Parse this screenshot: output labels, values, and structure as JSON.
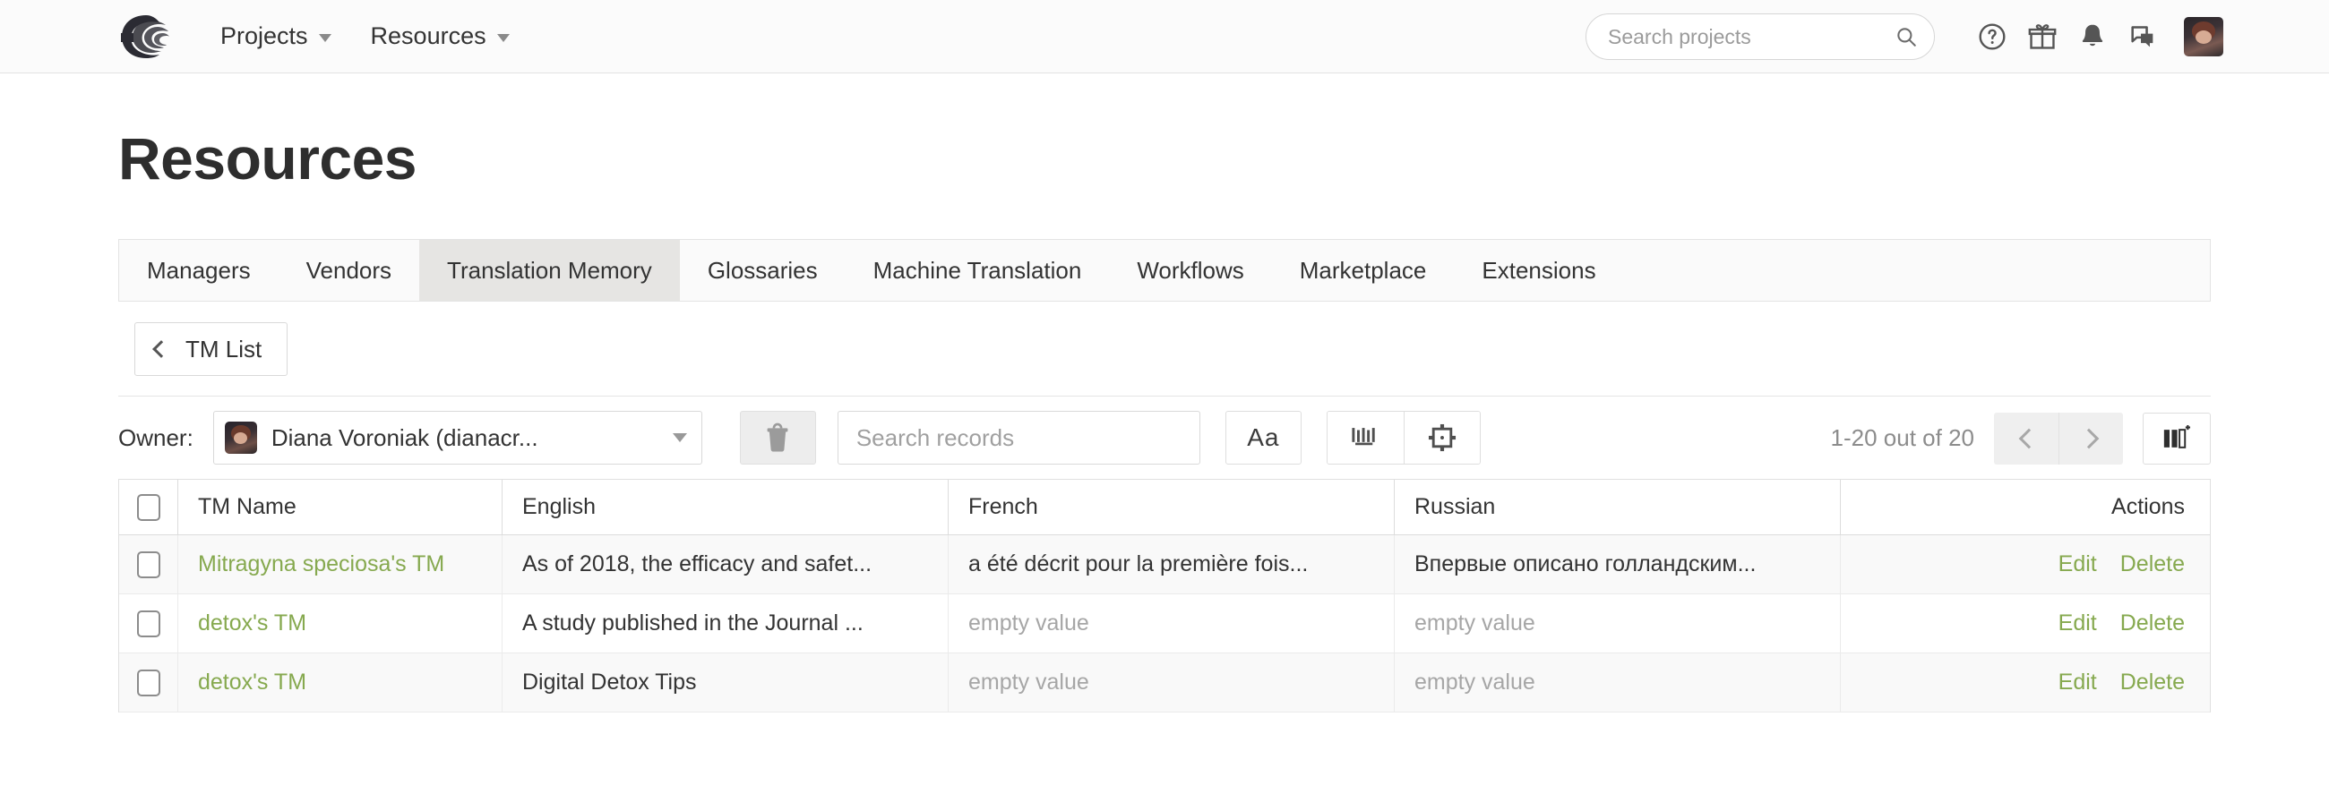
{
  "header": {
    "logo_name": "smartcat-logo",
    "nav": [
      {
        "label": "Projects",
        "name": "nav-projects"
      },
      {
        "label": "Resources",
        "name": "nav-resources"
      }
    ],
    "search": {
      "placeholder": "Search projects",
      "value": ""
    },
    "icons": [
      "help-icon",
      "gift-icon",
      "bell-icon",
      "chat-icon"
    ],
    "avatar_name": "user-avatar"
  },
  "page": {
    "title": "Resources"
  },
  "tabs": {
    "items": [
      "Managers",
      "Vendors",
      "Translation Memory",
      "Glossaries",
      "Machine Translation",
      "Workflows",
      "Marketplace",
      "Extensions"
    ],
    "active": "Translation Memory"
  },
  "subnav": {
    "back_label": "TM List"
  },
  "toolbar": {
    "owner_label": "Owner:",
    "owner_value": "Diana Voroniak (dianacr...",
    "delete_tooltip": "Delete",
    "search_placeholder": "Search records",
    "search_value": "",
    "case_label": "Aa",
    "tag_button": "tags-icon",
    "placeholder_button": "placeholder-icon",
    "pagination_text": "1-20 out of 20",
    "prev_label": "Previous page",
    "next_label": "Next page",
    "columns_label": "Add column"
  },
  "table": {
    "columns": [
      "TM Name",
      "English",
      "French",
      "Russian",
      "Actions"
    ],
    "rows": [
      {
        "name": "Mitragyna speciosa's TM",
        "english": "As of 2018, the efficacy and safet...",
        "french": "a été décrit pour la première fois...",
        "russian": "Впервые описано голландским...",
        "french_empty": false,
        "russian_empty": false,
        "edit": "Edit",
        "delete": "Delete"
      },
      {
        "name": "detox's TM",
        "english": "A study published in the Journal ...",
        "french": "empty value",
        "russian": "empty value",
        "french_empty": true,
        "russian_empty": true,
        "edit": "Edit",
        "delete": "Delete"
      },
      {
        "name": "detox's TM",
        "english": "Digital Detox Tips",
        "french": "empty value",
        "russian": "empty value",
        "french_empty": true,
        "russian_empty": true,
        "edit": "Edit",
        "delete": "Delete"
      }
    ]
  },
  "colors": {
    "link_green": "#86a94f",
    "active_tab_bg": "#e6e5e3",
    "muted_text": "#a6a6a6"
  }
}
